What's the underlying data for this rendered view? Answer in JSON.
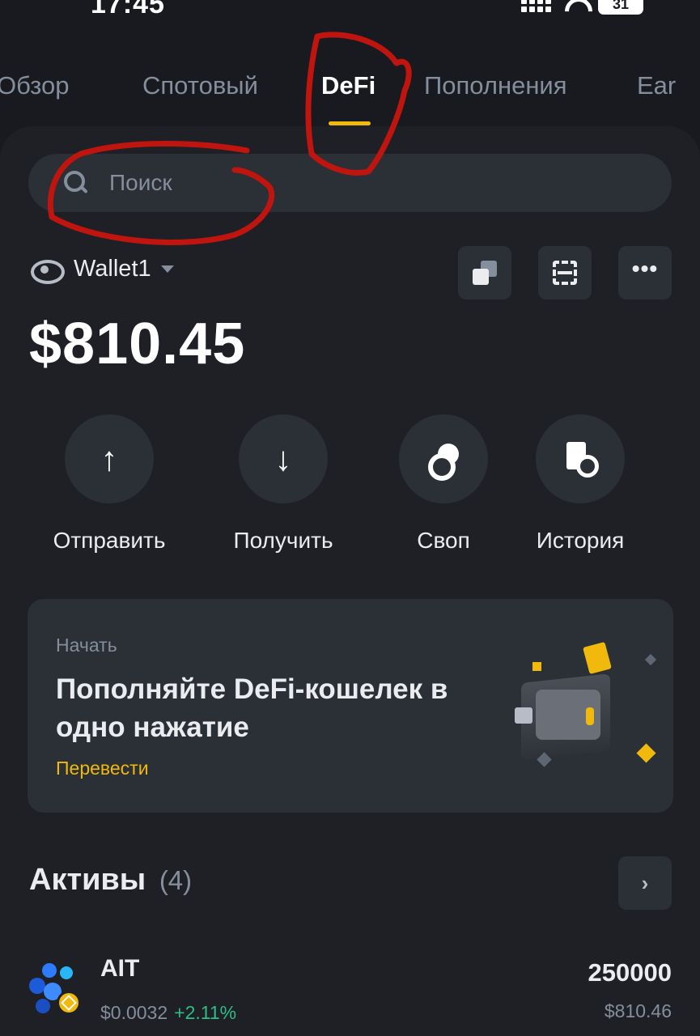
{
  "status_bar": {
    "time": "17:45",
    "battery": "31"
  },
  "tabs": [
    {
      "label": "Обзор"
    },
    {
      "label": "Спотовый"
    },
    {
      "label": "DeFi",
      "active": true
    },
    {
      "label": "Пополнения"
    },
    {
      "label": "Ear"
    }
  ],
  "search": {
    "placeholder": "Поиск"
  },
  "wallet": {
    "name": "Wallet1",
    "balance": "$810.45"
  },
  "actions": [
    {
      "label": "Отправить",
      "icon": "arrow-up-icon",
      "glyph": "↑"
    },
    {
      "label": "Получить",
      "icon": "arrow-down-icon",
      "glyph": "↓"
    },
    {
      "label": "Своп",
      "icon": "swap-icon"
    },
    {
      "label": "История",
      "icon": "history-icon"
    }
  ],
  "promo": {
    "kicker": "Начать",
    "title": "Пополняйте DeFi-кошелек в одно нажатие",
    "link": "Перевести"
  },
  "assets": {
    "title": "Активы",
    "count": "(4)",
    "arrow": "›",
    "items": [
      {
        "symbol": "AIT",
        "price": "$0.0032",
        "change": "+2.11%",
        "amount": "250000",
        "value": "$810.46"
      }
    ]
  },
  "colors": {
    "background": "#181a20",
    "panel": "#1e2026",
    "accent": "#f0b90b",
    "positive": "#2ebd85",
    "annotation": "#c0150f"
  }
}
